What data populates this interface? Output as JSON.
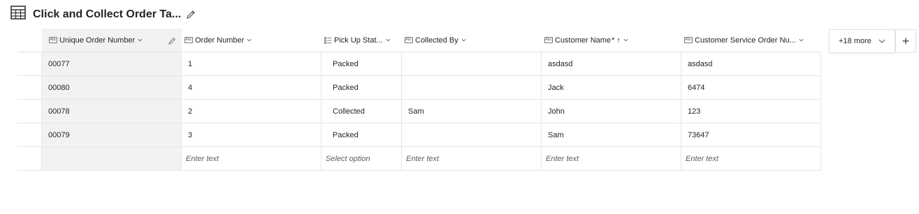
{
  "title": "Click and Collect Order Ta...",
  "columns": [
    {
      "label": "Unique Order Number",
      "icon": "text-field-icon",
      "suffix": "",
      "extra": "edit"
    },
    {
      "label": "Order Number",
      "icon": "text-field-icon",
      "suffix": ""
    },
    {
      "label": "Pick Up Stat...",
      "icon": "choice-field-icon",
      "suffix": ""
    },
    {
      "label": "Collected By",
      "icon": "text-field-icon",
      "suffix": ""
    },
    {
      "label": "Customer Name",
      "icon": "text-field-icon",
      "suffix": "* ↑"
    },
    {
      "label": "Customer Service Order Nu...",
      "icon": "text-field-icon",
      "suffix": ""
    }
  ],
  "rows": [
    [
      "00077",
      "1",
      "Packed",
      "",
      "asdasd",
      "asdasd"
    ],
    [
      "00080",
      "4",
      "Packed",
      "",
      "Jack",
      "6474"
    ],
    [
      "00078",
      "2",
      "Collected",
      "Sam",
      "John",
      "123"
    ],
    [
      "00079",
      "3",
      "Packed",
      "",
      "Sam",
      "73647"
    ]
  ],
  "new_row_placeholders": [
    "",
    "Enter text",
    "Select option",
    "Enter text",
    "Enter text",
    "Enter text"
  ],
  "more_columns_label": "+18 more",
  "add_column_label": "+",
  "colors": {
    "border": "#e6e6e6",
    "selected_col": "#f3f2f1",
    "text": "#242424"
  }
}
